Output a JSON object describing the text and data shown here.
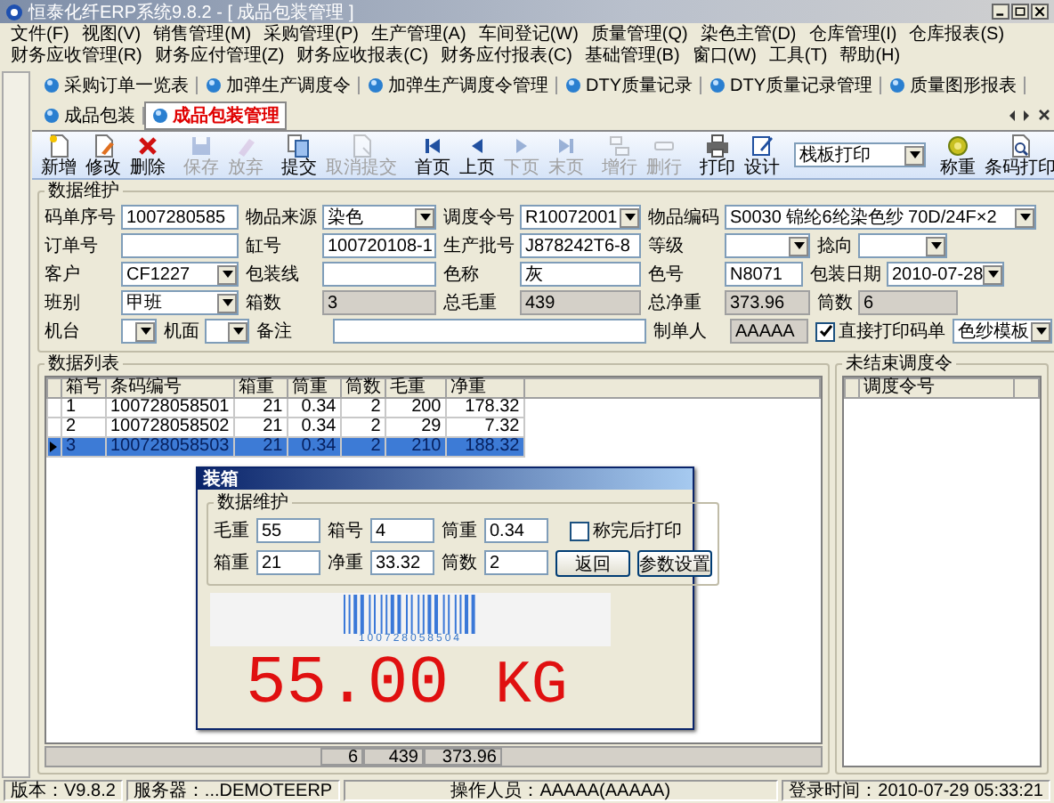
{
  "window": {
    "title": "恒泰化纤ERP系统9.8.2 - [ 成品包装管理 ]"
  },
  "menu": [
    "文件(F)",
    "视图(V)",
    "销售管理(M)",
    "采购管理(P)",
    "生产管理(A)",
    "车间登记(W)",
    "质量管理(Q)",
    "染色主管(D)",
    "仓库管理(I)",
    "仓库报表(S)",
    "财务应收管理(R)",
    "财务应付管理(Z)",
    "财务应收报表(C)",
    "财务应付报表(C)",
    "基础管理(B)",
    "窗口(W)",
    "工具(T)",
    "帮助(H)"
  ],
  "tabs": [
    {
      "label": "采购订单一览表",
      "selected": false
    },
    {
      "label": "加弹生产调度令",
      "selected": false
    },
    {
      "label": "加弹生产调度令管理",
      "selected": false
    },
    {
      "label": "DTY质量记录",
      "selected": false
    },
    {
      "label": "DTY质量记录管理",
      "selected": false
    },
    {
      "label": "质量图形报表",
      "selected": false
    },
    {
      "label": "成品包装",
      "selected": false
    },
    {
      "label": "成品包装管理",
      "selected": true
    }
  ],
  "toolbar": {
    "groups": [
      [
        {
          "kind": "button",
          "label": "新增",
          "disabled": false
        },
        {
          "kind": "button",
          "label": "修改",
          "disabled": false
        },
        {
          "kind": "button",
          "label": "删除",
          "disabled": false
        }
      ],
      [
        {
          "kind": "button",
          "label": "保存",
          "disabled": true
        },
        {
          "kind": "button",
          "label": "放弃",
          "disabled": true
        }
      ],
      [
        {
          "kind": "button",
          "label": "提交",
          "disabled": false
        },
        {
          "kind": "button",
          "label": "取消提交",
          "disabled": true
        }
      ],
      [
        {
          "kind": "button",
          "label": "首页",
          "disabled": false
        },
        {
          "kind": "button",
          "label": "上页",
          "disabled": false
        },
        {
          "kind": "button",
          "label": "下页",
          "disabled": true
        },
        {
          "kind": "button",
          "label": "末页",
          "disabled": true
        }
      ],
      [
        {
          "kind": "button",
          "label": "增行",
          "disabled": true
        },
        {
          "kind": "button",
          "label": "删行",
          "disabled": true
        }
      ],
      [
        {
          "kind": "button",
          "label": "打印",
          "disabled": false
        },
        {
          "kind": "button",
          "label": "设计",
          "disabled": false
        }
      ],
      [
        {
          "kind": "combo",
          "value": "栈板打印"
        }
      ],
      [
        {
          "kind": "button",
          "label": "称重",
          "disabled": false
        },
        {
          "kind": "button",
          "label": "条码打印",
          "disabled": false
        }
      ]
    ]
  },
  "form": {
    "title": "数据维护",
    "rows": [
      {
        "fields": [
          {
            "label": "码单序号",
            "kind": "text",
            "value": "1007280585"
          },
          {
            "label": "物品来源",
            "kind": "combo",
            "value": "染色"
          },
          {
            "label": "调度令号",
            "kind": "combo",
            "value": "R10072001"
          },
          {
            "label": "物品编码",
            "kind": "combo",
            "value": "S0030 锦纶6纶染色纱 70D/24F×2"
          }
        ]
      },
      {
        "fields": [
          {
            "label": "订单号",
            "kind": "text"
          },
          {
            "label": "缸号",
            "kind": "text",
            "value": "100720108-1"
          },
          {
            "label": "生产批号",
            "kind": "text",
            "value": "J878242T6-8"
          },
          {
            "label": "等级",
            "kind": "combo"
          },
          {
            "label": "捻向",
            "kind": "combo"
          }
        ]
      },
      {
        "fields": [
          {
            "label": "客户",
            "kind": "combo",
            "value": "CF1227"
          },
          {
            "label": "包装线",
            "kind": "text"
          },
          {
            "label": "色称",
            "kind": "text",
            "value": "灰"
          },
          {
            "label": "色号",
            "kind": "text",
            "value": "N8071"
          },
          {
            "label": "包装日期",
            "kind": "combo",
            "value": "2010-07-28"
          }
        ]
      },
      {
        "fields": [
          {
            "label": "班别",
            "kind": "combo",
            "value": "甲班"
          },
          {
            "label": "箱数",
            "kind": "readonly",
            "value": "3"
          },
          {
            "label": "总毛重",
            "kind": "readonly",
            "value": "439"
          },
          {
            "label": "总净重",
            "kind": "readonly",
            "value": "373.96"
          },
          {
            "label": "筒数",
            "kind": "readonly",
            "value": "6"
          }
        ]
      },
      {
        "fields": [
          {
            "label": "机台",
            "kind": "combo"
          },
          {
            "label": "机面",
            "kind": "combo"
          },
          {
            "label": "备注",
            "kind": "text"
          },
          {
            "label": "制单人",
            "kind": "readonly",
            "value": "AAAAA"
          },
          {
            "label": "直接打印码单",
            "kind": "checkbox",
            "checked": true
          },
          {
            "kind": "combo",
            "value": "色纱模板"
          }
        ]
      }
    ]
  },
  "grid": {
    "title": "数据列表",
    "columns": [
      "箱号",
      "条码编号",
      "箱重",
      "筒重",
      "筒数",
      "毛重",
      "净重"
    ],
    "rows": [
      {
        "cells": [
          "1",
          "100728058501",
          "21",
          "0.34",
          "2",
          "200",
          "178.32"
        ],
        "selected": false
      },
      {
        "cells": [
          "2",
          "100728058502",
          "21",
          "0.34",
          "2",
          "29",
          "7.32"
        ],
        "selected": false
      },
      {
        "cells": [
          "3",
          "100728058503",
          "21",
          "0.34",
          "2",
          "210",
          "188.32"
        ],
        "selected": true
      }
    ],
    "totals": {
      "tube_count": "6",
      "gross_weight": "439",
      "net_weight": "373.96"
    }
  },
  "pending_orders": {
    "title": "未结束调度令",
    "columns": [
      "调度令号"
    ]
  },
  "dialog": {
    "title": "装箱",
    "group_title": "数据维护",
    "fields": [
      {
        "label": "毛重",
        "value": "55"
      },
      {
        "label": "箱号",
        "value": "4"
      },
      {
        "label": "筒重",
        "value": "0.34"
      },
      {
        "label": "箱重",
        "value": "21"
      },
      {
        "label": "净重",
        "value": "33.32"
      },
      {
        "label": "筒数",
        "value": "2"
      }
    ],
    "print_after_weighing": {
      "label": "称完后打印",
      "checked": false
    },
    "buttons": [
      "返回",
      "参数设置"
    ],
    "barcode": "100728058504",
    "weight": "55.00",
    "unit": "KG"
  },
  "status_bar": [
    "版本：V9.8.2",
    "服务器：...DEMOTEERP",
    "操作人员：AAAAA(AAAAA)",
    "登录时间：2010-07-29 05:33:21"
  ]
}
